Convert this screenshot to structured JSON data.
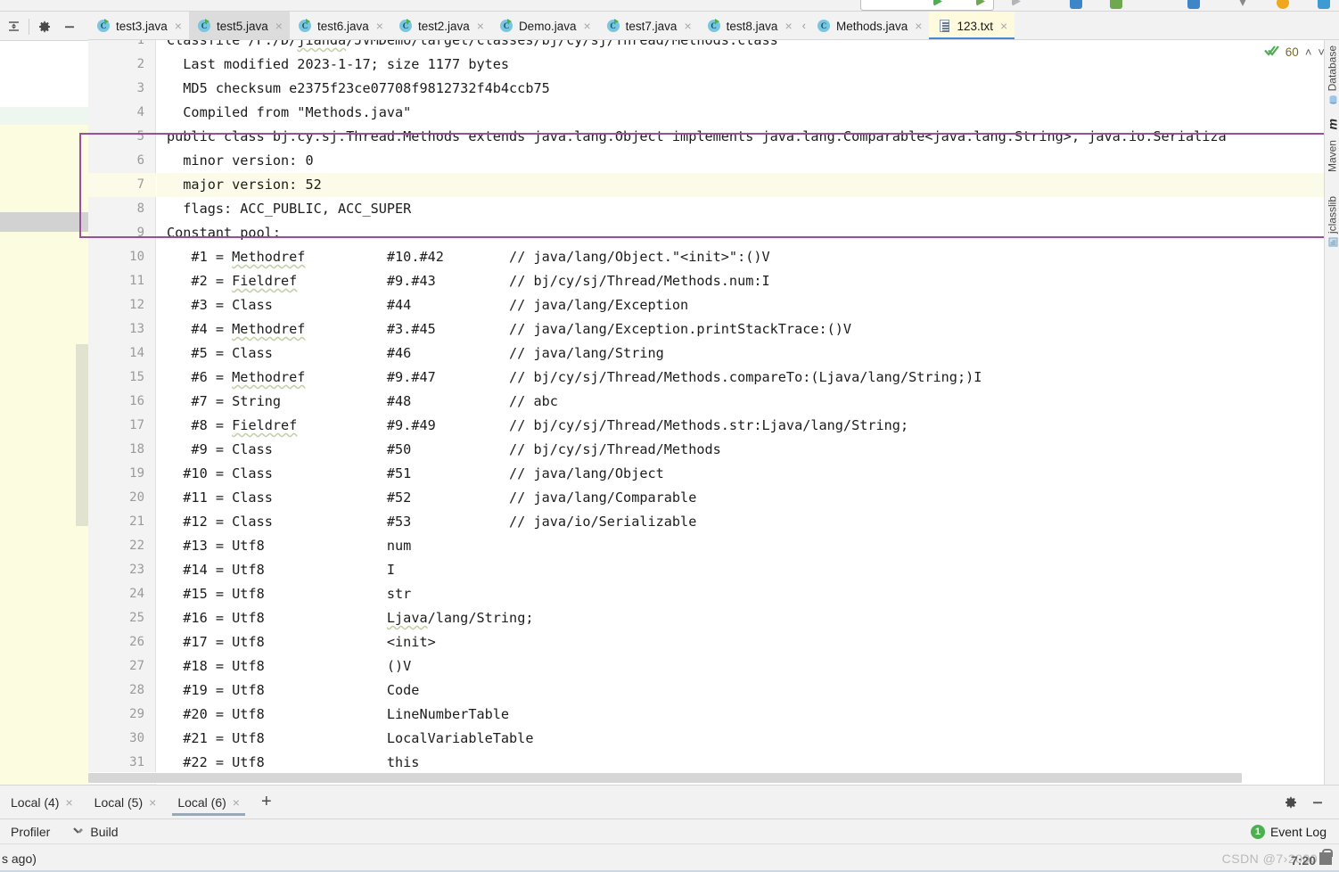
{
  "window": {
    "left_toolbar": {
      "collapse_icon": "collapse-all-icon",
      "settings_icon": "gear-icon",
      "hide_icon": "minimize-icon"
    }
  },
  "editor_tabs": {
    "overflow_chevron": "‹",
    "items": [
      {
        "label": "test3.java",
        "icon": "java-class-icon",
        "state": "normal"
      },
      {
        "label": "test5.java",
        "icon": "java-class-icon",
        "state": "selected"
      },
      {
        "label": "test6.java",
        "icon": "java-class-icon",
        "state": "normal"
      },
      {
        "label": "test2.java",
        "icon": "java-class-icon",
        "state": "normal"
      },
      {
        "label": "Demo.java",
        "icon": "java-class-icon",
        "state": "normal"
      },
      {
        "label": "test7.java",
        "icon": "java-class-icon",
        "state": "normal"
      },
      {
        "label": "test8.java",
        "icon": "java-class-icon",
        "state": "normal"
      },
      {
        "label": "Methods.java",
        "icon": "java-class-plain-icon",
        "state": "normal"
      },
      {
        "label": "123.txt",
        "icon": "text-file-icon",
        "state": "active"
      }
    ],
    "close_glyph": "×"
  },
  "inspections": {
    "icon": "inspection-check-icon",
    "count": "60",
    "prev_glyph": "˄",
    "next_glyph": "˅"
  },
  "editor": {
    "current_line": 7,
    "first_line": 1,
    "lines": [
      "Classfile /F:/D/jianda/JVMDemo/target/classes/bj/cy/sj/Thread/Methods.class",
      "  Last modified 2023-1-17; size 1177 bytes",
      "  MD5 checksum e2375f23ce07708f9812732f4b4ccb75",
      "  Compiled from \"Methods.java\"",
      "public class bj.cy.sj.Thread.Methods extends java.lang.Object implements java.lang.Comparable<java.lang.String>, java.io.Serializa",
      "  minor version: 0",
      "  major version: 52",
      "  flags: ACC_PUBLIC, ACC_SUPER",
      "Constant pool:",
      "   #1 = Methodref          #10.#42        // java/lang/Object.\"<init>\":()V",
      "   #2 = Fieldref           #9.#43         // bj/cy/sj/Thread/Methods.num:I",
      "   #3 = Class              #44            // java/lang/Exception",
      "   #4 = Methodref          #3.#45         // java/lang/Exception.printStackTrace:()V",
      "   #5 = Class              #46            // java/lang/String",
      "   #6 = Methodref          #9.#47         // bj/cy/sj/Thread/Methods.compareTo:(Ljava/lang/String;)I",
      "   #7 = String             #48            // abc",
      "   #8 = Fieldref           #9.#49         // bj/cy/sj/Thread/Methods.str:Ljava/lang/String;",
      "   #9 = Class              #50            // bj/cy/sj/Thread/Methods",
      "  #10 = Class              #51            // java/lang/Object",
      "  #11 = Class              #52            // java/lang/Comparable",
      "  #12 = Class              #53            // java/io/Serializable",
      "  #13 = Utf8               num",
      "  #14 = Utf8               I",
      "  #15 = Utf8               str",
      "  #16 = Utf8               Ljava/lang/String;",
      "  #17 = Utf8               <init>",
      "  #18 = Utf8               ()V",
      "  #19 = Utf8               Code",
      "  #20 = Utf8               LineNumberTable",
      "  #21 = Utf8               LocalVariableTable",
      "  #22 = Utf8               this"
    ]
  },
  "right_tool_stripe": {
    "items": [
      {
        "label": "Database",
        "icon": "database-icon"
      },
      {
        "label": "m",
        "icon": "maven-m-icon"
      },
      {
        "label": "Maven",
        "icon": "maven-icon"
      },
      {
        "label": "jclasslib",
        "icon": "jclasslib-icon"
      }
    ]
  },
  "run_tabs": {
    "items": [
      {
        "label": "Local (4)",
        "active": false
      },
      {
        "label": "Local (5)",
        "active": false
      },
      {
        "label": "Local (6)",
        "active": true
      }
    ],
    "add_glyph": "+",
    "close_glyph": "×",
    "settings_icon": "gear-icon",
    "hide_icon": "minimize-icon"
  },
  "status_bar": {
    "profiler_label": "Profiler",
    "build_label": "Build",
    "build_icon": "hammer-icon",
    "event_log_label": "Event Log",
    "event_log_count": "1",
    "ago_text": "s ago)",
    "watermark": "CSDN @7›2000",
    "clock": "7:20",
    "tray_icon": "lock-icon"
  },
  "colors": {
    "accent_tab_underline": "#4588d3",
    "active_tab_bg": "#fdfade",
    "selection_rect": "#9b4e9b",
    "current_line_bg": "#fcfae8",
    "editor_bg": "#ffffff",
    "chrome_bg": "#f2f2f2",
    "inspection_green": "#4caf50",
    "run_tab_underline": "#9aa7b5"
  }
}
